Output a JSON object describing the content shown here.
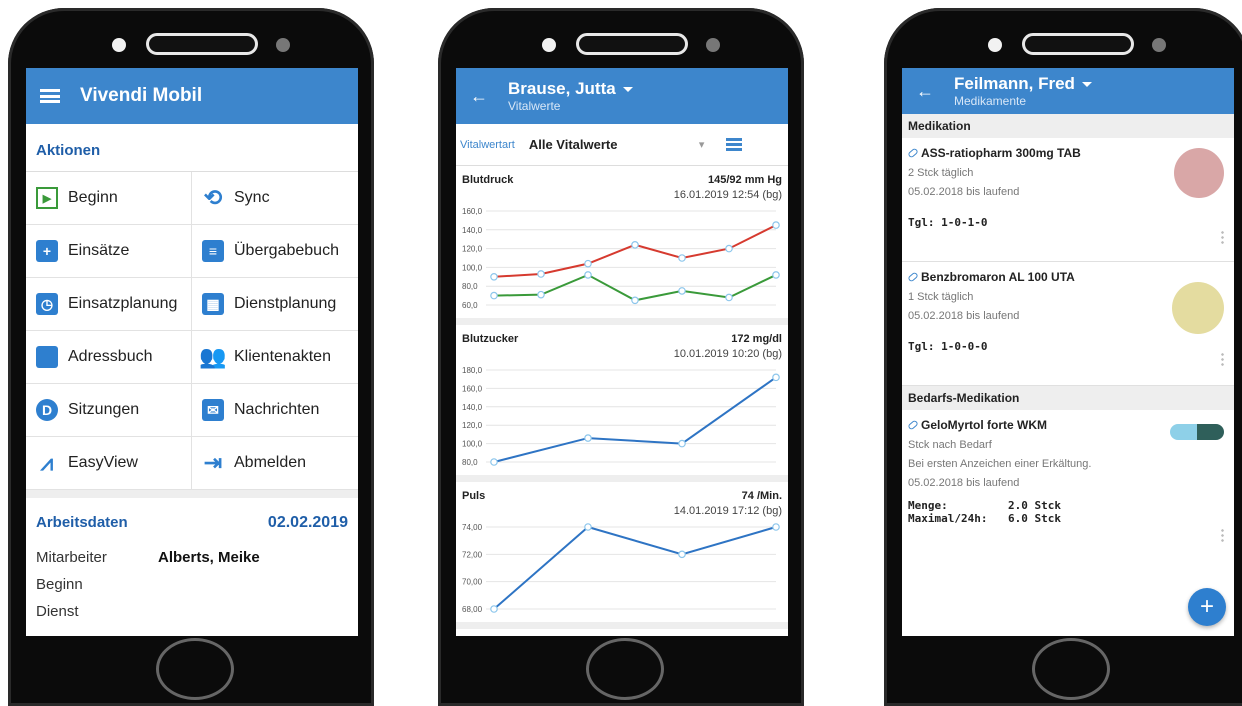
{
  "home": {
    "title": "Vivendi Mobil",
    "actions_header": "Aktionen",
    "actions": [
      {
        "label": "Beginn",
        "icon": "play-icon"
      },
      {
        "label": "Sync",
        "icon": "sync-icon"
      },
      {
        "label": "Einsätze",
        "icon": "plus-icon"
      },
      {
        "label": "Übergabebuch",
        "icon": "document-icon"
      },
      {
        "label": "Einsatzplanung",
        "icon": "calendar-clock-icon"
      },
      {
        "label": "Dienstplanung",
        "icon": "roster-icon"
      },
      {
        "label": "Adressbuch",
        "icon": "bookmark-icon"
      },
      {
        "label": "Klientenakten",
        "icon": "people-icon"
      },
      {
        "label": "Sitzungen",
        "icon": "session-d-icon"
      },
      {
        "label": "Nachrichten",
        "icon": "envelope-icon"
      },
      {
        "label": "EasyView",
        "icon": "chart-icon"
      },
      {
        "label": "Abmelden",
        "icon": "logout-icon"
      }
    ],
    "work_header": "Arbeitsdaten",
    "work_date": "02.02.2019",
    "rows": [
      {
        "label": "Mitarbeiter",
        "value": "Alberts, Meike"
      },
      {
        "label": "Beginn",
        "value": ""
      },
      {
        "label": "Dienst",
        "value": ""
      }
    ],
    "accent": "#3d86cc"
  },
  "vitals": {
    "patient": "Brause, Jutta",
    "subtitle": "Vitalwerte",
    "filter_label": "Vitalwertart",
    "filter_value": "Alle Vitalwerte",
    "cards": [
      {
        "name": "Blutdruck",
        "value": "145/92 mm Hg",
        "date": "16.01.2019 12:54 (bg)"
      },
      {
        "name": "Blutzucker",
        "value": "172 mg/dl",
        "date": "10.01.2019 10:20 (bg)"
      },
      {
        "name": "Puls",
        "value": "74 /Min.",
        "date": "14.01.2019 17:12 (bg)"
      }
    ]
  },
  "chart_data": [
    {
      "type": "line",
      "title": "Blutdruck",
      "ylim": [
        60,
        160
      ],
      "yticks": [
        "160,0",
        "140,0",
        "120,0",
        "100,0",
        "80,0",
        "60,0"
      ],
      "x": [
        1,
        2,
        3,
        4,
        5,
        6,
        7
      ],
      "series": [
        {
          "values": [
            90,
            93,
            104,
            124,
            110,
            120,
            145
          ],
          "color": "#d63a2f"
        },
        {
          "values": [
            70,
            71,
            92,
            65,
            75,
            68,
            92
          ],
          "color": "#3a9a3a"
        }
      ]
    },
    {
      "type": "line",
      "title": "Blutzucker",
      "ylim": [
        80,
        180
      ],
      "yticks": [
        "180,0",
        "160,0",
        "140,0",
        "120,0",
        "100,0",
        "80,0"
      ],
      "x": [
        1,
        2,
        3,
        4
      ],
      "series": [
        {
          "values": [
            80,
            106,
            100,
            172
          ],
          "color": "#2e74c4"
        }
      ]
    },
    {
      "type": "line",
      "title": "Puls",
      "ylim": [
        68,
        74
      ],
      "yticks": [
        "74,00",
        "72,00",
        "70,00",
        "68,00"
      ],
      "x": [
        1,
        2,
        3,
        4
      ],
      "series": [
        {
          "values": [
            68,
            74,
            72,
            74
          ],
          "color": "#2e74c4"
        }
      ]
    }
  ],
  "meds": {
    "patient": "Feilmann, Fred",
    "subtitle": "Medikamente",
    "section1": "Medikation",
    "items": [
      {
        "name": "ASS-ratiopharm 300mg TAB",
        "line1": "2 Stck täglich",
        "line2": "05.02.2018 bis laufend",
        "dose": "Tgl: 1-0-1-0",
        "pill_color": "#d9a7a7"
      },
      {
        "name": "Benzbromaron AL 100 UTA",
        "line1": "1 Stck täglich",
        "line2": "05.02.2018 bis laufend",
        "dose": "Tgl: 1-0-0-0",
        "pill_color": "#e4dca0"
      }
    ],
    "section2": "Bedarfs-Medikation",
    "prn": {
      "name": "GeloMyrtol forte WKM",
      "line1": "Stck nach Bedarf",
      "line2": "Bei ersten Anzeichen einer Erkältung.",
      "line3": "05.02.2018 bis laufend",
      "qty_label": "Menge:",
      "qty_value": "2.0 Stck",
      "max_label": "Maximal/24h:",
      "max_value": "6.0 Stck"
    },
    "fab": "+"
  }
}
